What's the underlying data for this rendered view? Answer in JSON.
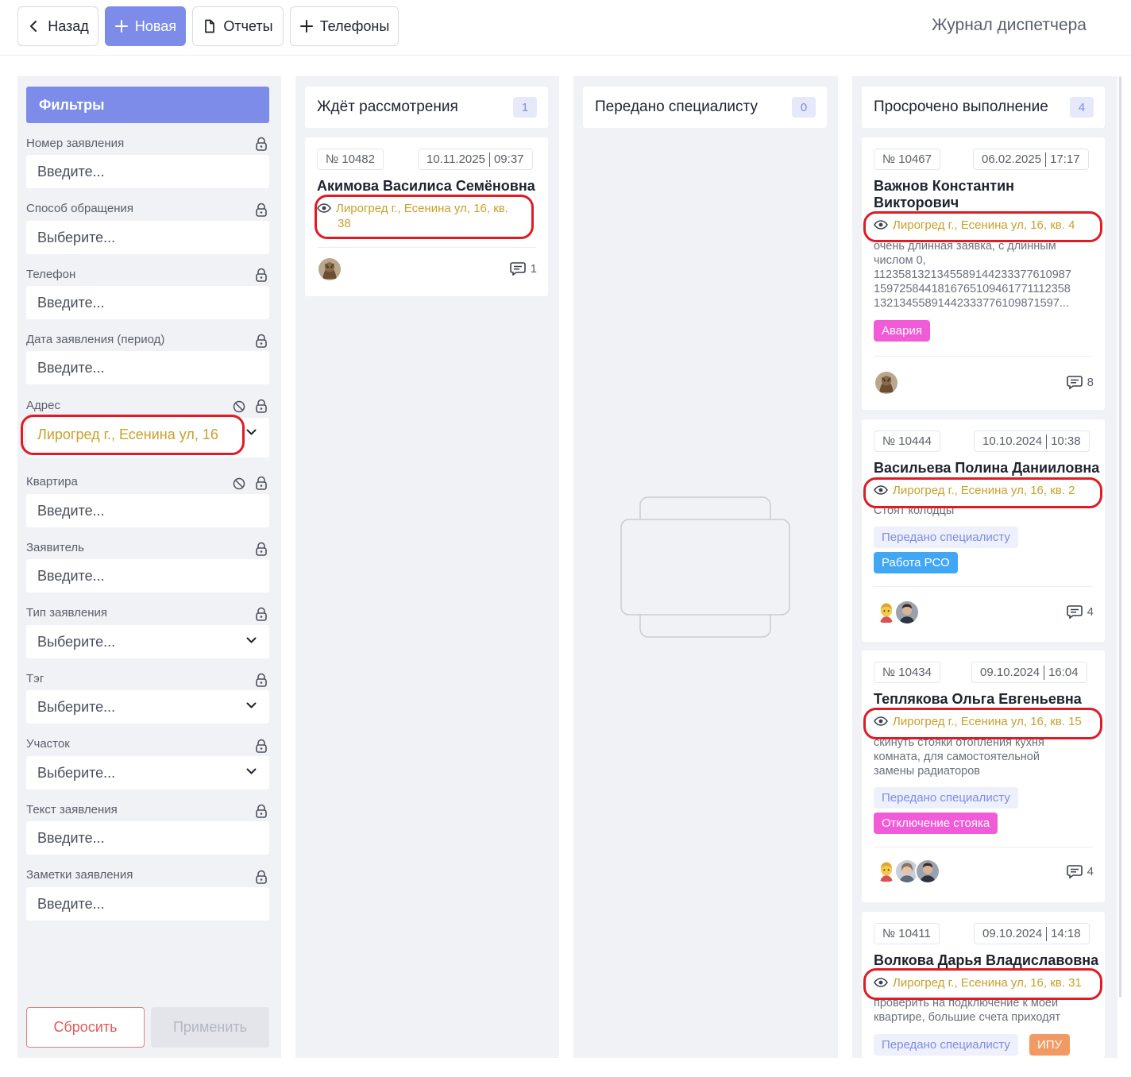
{
  "toolbar": {
    "back_label": "Назад",
    "new_label": "Новая",
    "reports_label": "Отчеты",
    "phones_label": "Телефоны",
    "page_title": "Журнал диспетчера"
  },
  "filters": {
    "title": "Фильтры",
    "fields": [
      {
        "label": "Номер заявления",
        "value": "Введите..."
      },
      {
        "label": "Способ обращения",
        "value": "Выберите..."
      },
      {
        "label": "Телефон",
        "value": "Введите..."
      },
      {
        "label": "Дата заявления (период)",
        "value": "Введите..."
      },
      {
        "label": "Адрес",
        "value": "Лирогред г., Есенина ул, 16"
      },
      {
        "label": "Квартира",
        "value": "Введите..."
      },
      {
        "label": "Заявитель",
        "value": "Введите..."
      },
      {
        "label": "Тип заявления",
        "value": "Выберите..."
      },
      {
        "label": "Тэг",
        "value": "Выберите..."
      },
      {
        "label": "Участок",
        "value": "Выберите..."
      },
      {
        "label": "Текст заявления",
        "value": "Введите..."
      },
      {
        "label": "Заметки заявления",
        "value": "Введите..."
      }
    ],
    "reset_label": "Сбросить",
    "apply_label": "Применить"
  },
  "columns": [
    {
      "title": "Ждёт рассмотрения",
      "count": "1",
      "cards": [
        {
          "number": "№ 10482",
          "date": "10.11.2025",
          "time": "09:37",
          "name": "Акимова Василиса Семёновна",
          "address_line1": "Лирогред г., Есенина ул, 16, кв.",
          "address_line2": "38",
          "comments": "1"
        }
      ]
    },
    {
      "title": "Передано специалисту",
      "count": "0",
      "cards": []
    },
    {
      "title": "Просрочено выполнение",
      "count": "4",
      "cards": [
        {
          "number": "№ 10467",
          "date": "06.02.2025",
          "time": "17:17",
          "name_line1": "Важнов Константин",
          "name_line2": "Викторович",
          "address": "Лирогред г., Есенина ул, 16, кв. 4",
          "desc": [
            "очень длинная заявка, с длинным",
            "числом 0,",
            "1123581321345589144233377610987",
            "1597258441816765109461771112358",
            "13213455891442333776109871597..."
          ],
          "tags": [
            "Авария"
          ],
          "comments": "8"
        },
        {
          "number": "№ 10444",
          "date": "10.10.2024",
          "time": "10:38",
          "name": "Васильева Полина Данииловна",
          "address": "Лирогред г., Есенина ул, 16, кв. 2",
          "desc": [
            "Стоят колодцы"
          ],
          "tags": [
            "Передано специалисту",
            "Работа РСО"
          ],
          "comments": "4"
        },
        {
          "number": "№ 10434",
          "date": "09.10.2024",
          "time": "16:04",
          "name": "Теплякова Ольга Евгеньевна",
          "address": "Лирогред г., Есенина ул, 16, кв. 15",
          "desc": [
            "скинуть стояки отопления кухня",
            "комната, для самостоятельной",
            "замены радиаторов"
          ],
          "tags": [
            "Передано специалисту",
            "Отключение стояка"
          ],
          "comments": "4"
        },
        {
          "number": "№ 10411",
          "date": "09.10.2024",
          "time": "14:18",
          "name": "Волкова Дарья Владиславовна",
          "address": "Лирогред г., Есенина ул, 16, кв. 31",
          "desc": [
            "проверить на подключение к моей",
            "квартире, большие счета приходят"
          ],
          "tags": [
            "Передано специалисту",
            "ИПУ"
          ]
        }
      ]
    }
  ],
  "icons": {
    "eye": "eye-icon",
    "lock": "lock-icon",
    "clear": "clear-icon",
    "comment": "comment-icon",
    "chevron": "chevron-down-icon"
  },
  "colors": {
    "accent": "#7d8ce8",
    "address": "#c9a02c",
    "highlight": "#e01b24",
    "tag_pink": "#f25bd8",
    "tag_blue": "#41a7f5",
    "tag_orange": "#f19a64"
  }
}
